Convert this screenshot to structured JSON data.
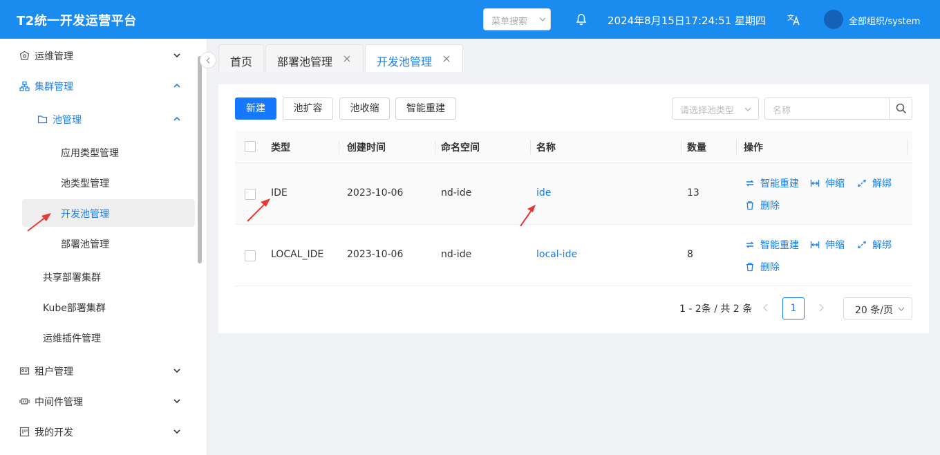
{
  "header": {
    "title": "T2统一开发运营平台",
    "menu_search_placeholder": "菜单搜索",
    "datetime": "2024年8月15日17:24:51 星期四",
    "org": "全部组织/system"
  },
  "sidebar": {
    "items": [
      {
        "label": "运维管理",
        "icon": "ops-icon"
      },
      {
        "label": "集群管理",
        "icon": "cluster-icon"
      },
      {
        "label": "池管理",
        "icon": "folder-icon"
      },
      {
        "label": "应用类型管理"
      },
      {
        "label": "池类型管理"
      },
      {
        "label": "开发池管理"
      },
      {
        "label": "部署池管理"
      },
      {
        "label": "共享部署集群"
      },
      {
        "label": "Kube部署集群"
      },
      {
        "label": "运维插件管理"
      },
      {
        "label": "租户管理",
        "icon": "tenant-icon"
      },
      {
        "label": "中间件管理",
        "icon": "middleware-icon"
      },
      {
        "label": "我的开发",
        "icon": "dev-icon"
      }
    ]
  },
  "tabs": [
    {
      "label": "首页"
    },
    {
      "label": "部署池管理"
    },
    {
      "label": "开发池管理"
    }
  ],
  "toolbar": {
    "new_label": "新建",
    "expand_label": "池扩容",
    "shrink_label": "池收缩",
    "rebuild_label": "智能重建",
    "type_placeholder": "请选择池类型",
    "name_placeholder": "名称"
  },
  "table": {
    "columns": [
      "类型",
      "创建时间",
      "命名空间",
      "名称",
      "数量",
      "操作"
    ],
    "rows": [
      {
        "type": "IDE",
        "created": "2023-10-06",
        "namespace": "nd-ide",
        "name": "ide",
        "count": "13"
      },
      {
        "type": "LOCAL_IDE",
        "created": "2023-10-06",
        "namespace": "nd-ide",
        "name": "local-ide",
        "count": "8"
      }
    ],
    "actions": {
      "rebuild": "智能重建",
      "scale": "伸缩",
      "unbind": "解绑",
      "delete": "删除"
    }
  },
  "pagination": {
    "total": "1 - 2条 / 共 2 条",
    "current_page": "1",
    "page_size": "20 条/页"
  },
  "colors": {
    "header_bg": "#1a8cf0",
    "accent": "#1677ff",
    "annotation_arrow": "#e53935"
  }
}
